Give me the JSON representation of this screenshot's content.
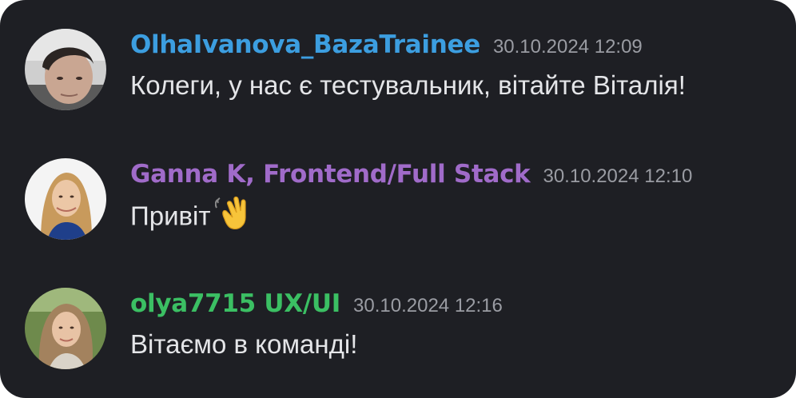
{
  "messages": [
    {
      "username": "OlhaIvanova_BazaTrainee",
      "username_color": "#3c9ee0",
      "timestamp": "30.10.2024 12:09",
      "text": "Колеги, у нас є тестувальник, вітайте Віталія!",
      "avatar_icon": "user-avatar-photo"
    },
    {
      "username": "Ganna K, Frontend/Full Stack",
      "username_color": "#a06bc9",
      "timestamp": "30.10.2024 12:10",
      "text": "Привіт",
      "emoji": "waving-hand-icon",
      "avatar_icon": "user-avatar-photo"
    },
    {
      "username": "olya7715 UX/UI",
      "username_color": "#3bbf63",
      "timestamp": "30.10.2024 12:16",
      "text": "Вітаємо в команді!",
      "avatar_icon": "user-avatar-photo"
    }
  ],
  "colors": {
    "background": "#1e1f24",
    "message_text": "#e4e5e8",
    "timestamp_text": "#9a9ca3"
  }
}
